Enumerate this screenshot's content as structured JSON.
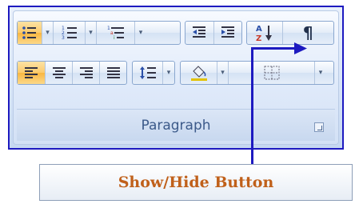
{
  "ribbon": {
    "group_label": "Paragraph",
    "row1": [
      {
        "name": "bullets-button",
        "icon": "bullets-icon",
        "active": true,
        "dropdown": true
      },
      {
        "name": "numbering-button",
        "icon": "numbering-icon",
        "active": false,
        "dropdown": true
      },
      {
        "name": "multilevel-list-button",
        "icon": "multilevel-list-icon",
        "active": false,
        "dropdown": true
      },
      {
        "name": "decrease-indent-button",
        "icon": "decrease-indent-icon"
      },
      {
        "name": "increase-indent-button",
        "icon": "increase-indent-icon"
      },
      {
        "name": "sort-button",
        "icon": "sort-az-icon",
        "label_top": "A",
        "label_bottom": "Z"
      },
      {
        "name": "show-hide-button",
        "icon": "pilcrow-icon",
        "glyph": "¶"
      }
    ],
    "row2": [
      {
        "name": "align-left-button",
        "icon": "align-left-icon",
        "active": true
      },
      {
        "name": "center-button",
        "icon": "align-center-icon"
      },
      {
        "name": "align-right-button",
        "icon": "align-right-icon"
      },
      {
        "name": "justify-button",
        "icon": "justify-icon"
      },
      {
        "name": "line-spacing-button",
        "icon": "line-spacing-icon",
        "dropdown": true
      },
      {
        "name": "shading-button",
        "icon": "shading-bucket-icon",
        "dropdown": true
      },
      {
        "name": "borders-button",
        "icon": "borders-icon",
        "dropdown": true
      }
    ]
  },
  "callout": {
    "label": "Show/Hide Button"
  },
  "colors": {
    "callout_border": "#1d1ac0",
    "callout_text": "#c0601a",
    "active_fill": "#f9b640"
  }
}
